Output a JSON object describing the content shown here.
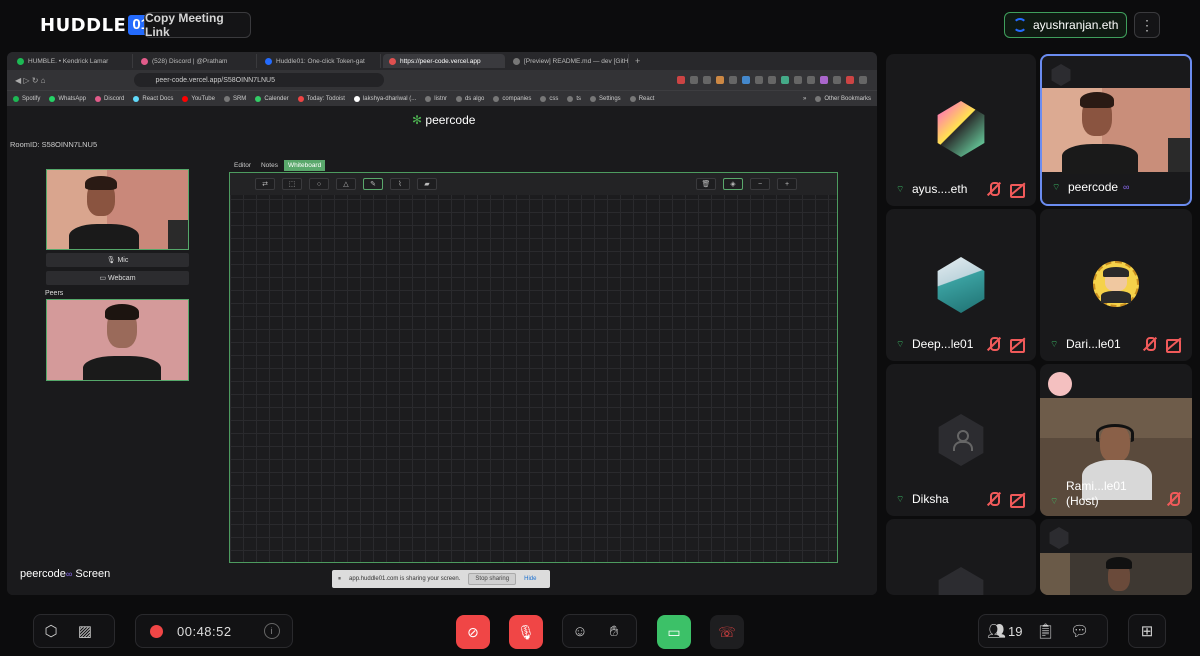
{
  "app": {
    "logo_text": "HUDDLE",
    "logo_badge": "01",
    "copy_link_label": "Copy Meeting Link",
    "wallet_label": "ayushranjan.eth"
  },
  "screen_share": {
    "browser_tabs": [
      {
        "label": "HUMBLE. • Kendrick Lamar",
        "active": false
      },
      {
        "label": "(528) Discord | @Pratham",
        "active": false
      },
      {
        "label": "Huddle01: One-click Token-gat",
        "active": false
      },
      {
        "label": "https://peer-code.vercel.app",
        "active": true
      },
      {
        "label": "[Preview] README.md — dev [GitH",
        "active": false
      }
    ],
    "url": "peer-code.vercel.app/S58OINN7LNU5",
    "bookmarks": [
      "Spotify",
      "WhatsApp",
      "Discord",
      "React Docs",
      "YouTube",
      "SRM",
      "Calender",
      "Today: Todoist",
      "lakshya-dhariwal (...",
      "listnr",
      "ds algo",
      "companies",
      "css",
      "ts",
      "Settings",
      "React"
    ],
    "other_bookmarks": "Other Bookmarks",
    "page_title": "peercode",
    "room_id": "RoomID: S58OINN7LNU5",
    "mic_label": "Mic",
    "webcam_label": "Webcam",
    "peers_label": "Peers",
    "tabs": [
      "Editor",
      "Notes",
      "Whiteboard"
    ],
    "active_tab": "Whiteboard",
    "share_banner_text": "app.huddle01.com is sharing your screen.",
    "stop_sharing_label": "Stop sharing",
    "hide_label": "Hide",
    "presenter_label": "peercode",
    "presenter_suffix": "Screen"
  },
  "participants": [
    {
      "name": "ayus....eth",
      "avatar": "nft-avatar",
      "mic_muted": true,
      "cam_off": true
    },
    {
      "name": "peercode",
      "avatar": "video",
      "active_speaker": true
    },
    {
      "name": "Deep...le01",
      "avatar": "nft-avatar",
      "mic_muted": true,
      "cam_off": true
    },
    {
      "name": "Dari...le01",
      "avatar": "nft-avatar",
      "mic_muted": true,
      "cam_off": true
    },
    {
      "name": "Diksha",
      "avatar": "default",
      "mic_muted": true,
      "cam_off": true
    },
    {
      "name": "Rami...le01",
      "name_line2": "(Host)",
      "avatar": "video",
      "mic_muted": true
    },
    {
      "name": "",
      "avatar": "default"
    },
    {
      "name": "",
      "avatar": "video"
    }
  ],
  "bottom_bar": {
    "timer": "00:48:52",
    "participant_count": "19"
  },
  "colors": {
    "accent_blue": "#246bfd",
    "danger_red": "#f04646",
    "success_green": "#3cc168",
    "active_border": "#6b8cf0"
  }
}
